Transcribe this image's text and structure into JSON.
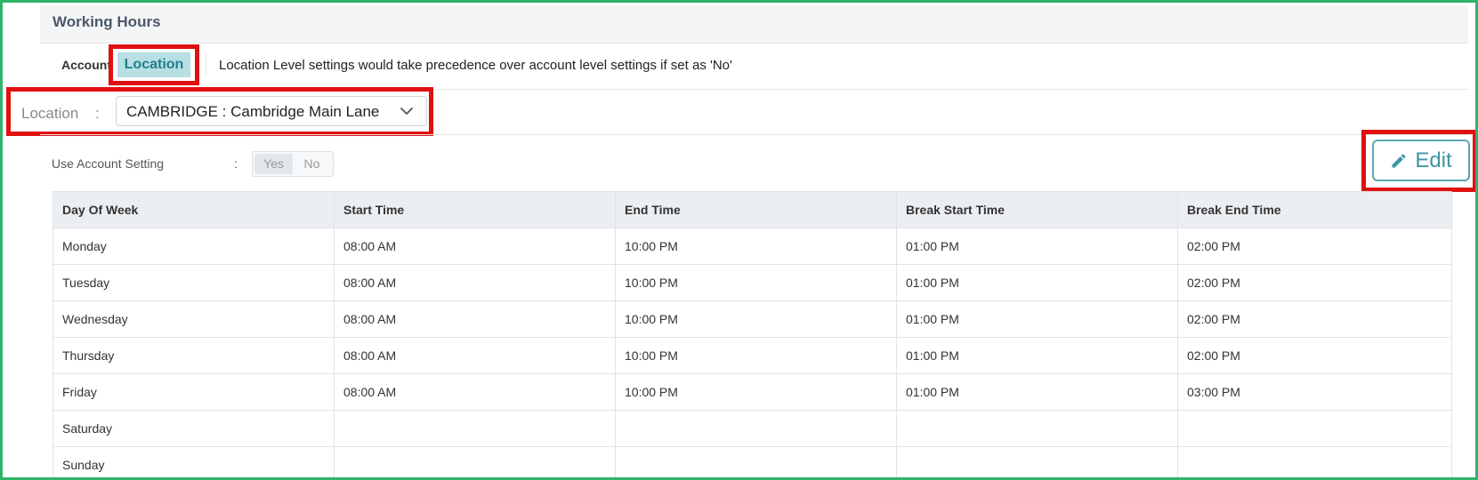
{
  "header": {
    "title": "Working Hours"
  },
  "tabs": {
    "account_label": "Account",
    "location_label": "Location",
    "note": "Location Level settings would take precedence over account level settings if set as 'No'"
  },
  "location": {
    "label": "Location",
    "colon": ":",
    "selected": "CAMBRIDGE : Cambridge Main Lane"
  },
  "use_account_setting": {
    "label": "Use Account Setting",
    "colon": ":",
    "yes": "Yes",
    "no": "No",
    "selected": "Yes"
  },
  "edit": {
    "label": "Edit",
    "icon": "pencil-icon"
  },
  "table": {
    "headers": [
      "Day Of Week",
      "Start Time",
      "End Time",
      "Break Start Time",
      "Break End Time"
    ],
    "rows": [
      [
        "Monday",
        "08:00 AM",
        "10:00 PM",
        "01:00 PM",
        "02:00 PM"
      ],
      [
        "Tuesday",
        "08:00 AM",
        "10:00 PM",
        "01:00 PM",
        "02:00 PM"
      ],
      [
        "Wednesday",
        "08:00 AM",
        "10:00 PM",
        "01:00 PM",
        "02:00 PM"
      ],
      [
        "Thursday",
        "08:00 AM",
        "10:00 PM",
        "01:00 PM",
        "02:00 PM"
      ],
      [
        "Friday",
        "08:00 AM",
        "10:00 PM",
        "01:00 PM",
        "03:00 PM"
      ],
      [
        "Saturday",
        "",
        "",
        "",
        ""
      ],
      [
        "Sunday",
        "",
        "",
        "",
        ""
      ]
    ]
  },
  "colors": {
    "highlight_border": "#e01010",
    "frame_border": "#2fb36a",
    "accent": "#3d97a4",
    "active_tab_bg": "#b7dfe4"
  }
}
